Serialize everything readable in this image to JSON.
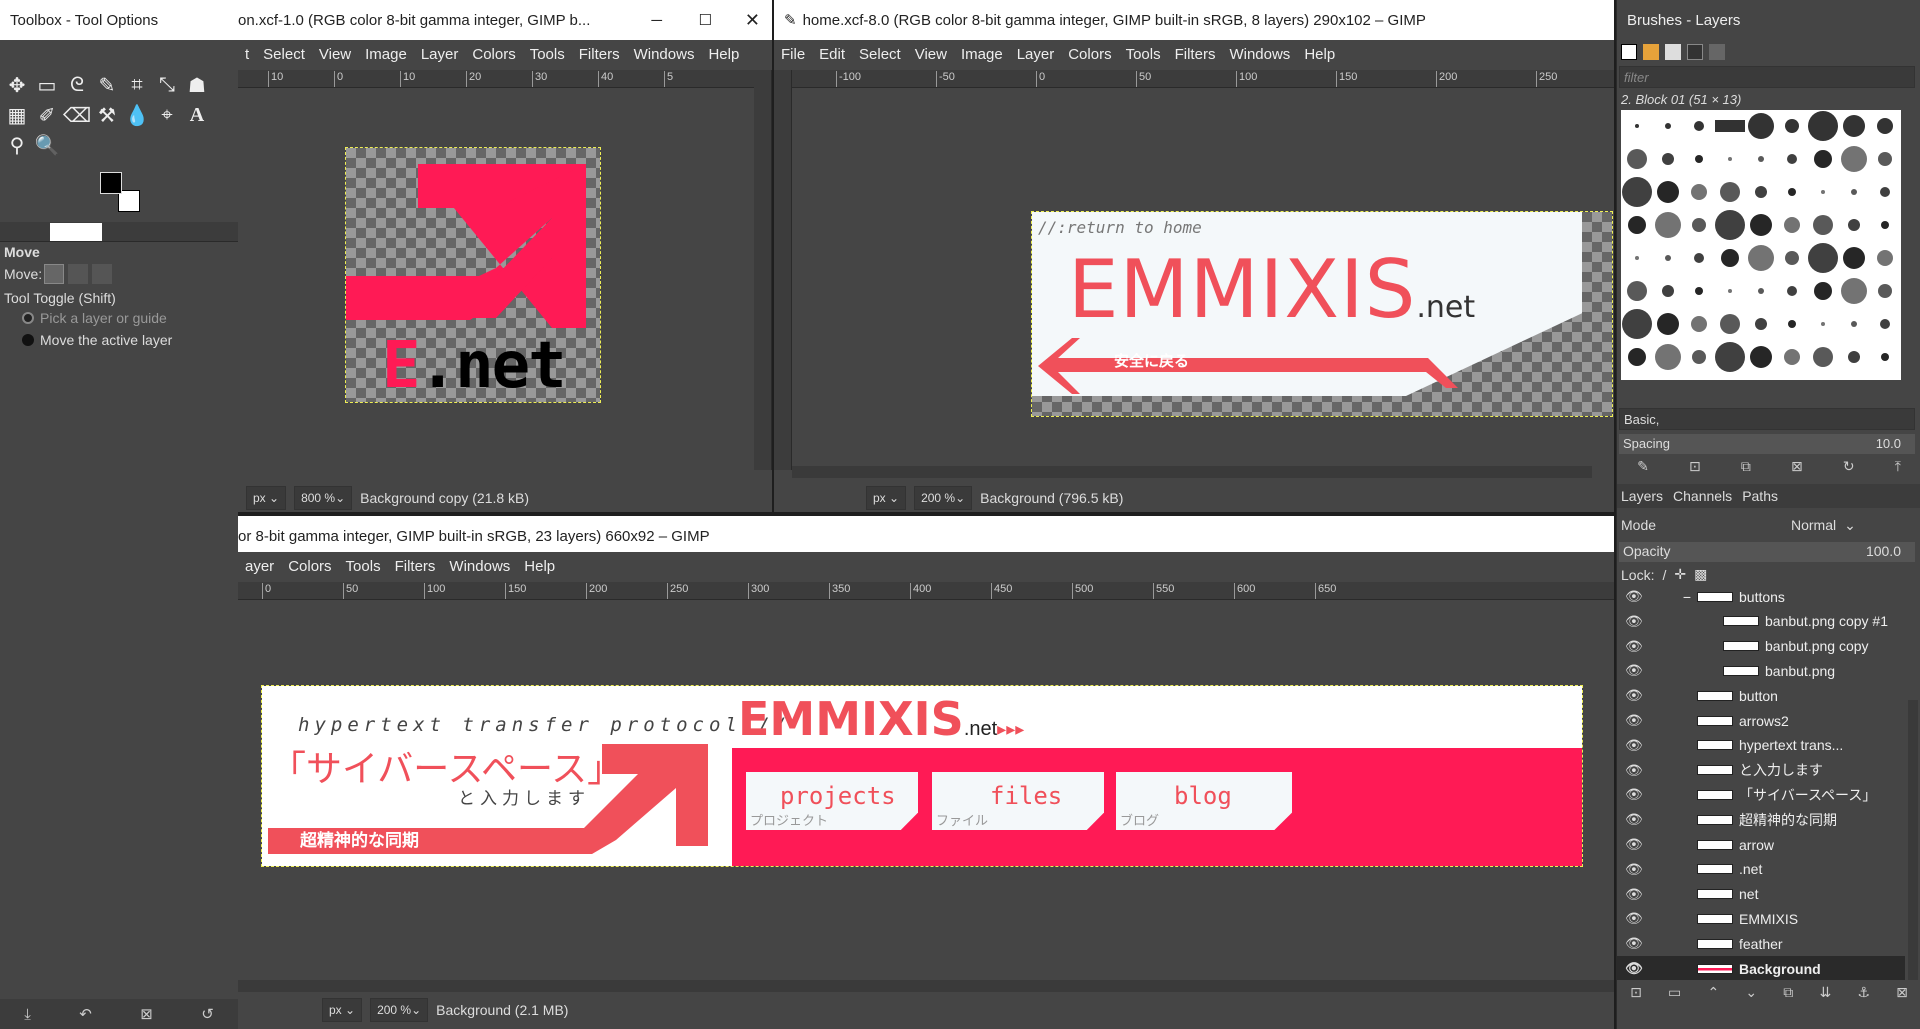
{
  "toolbox": {
    "title": "Toolbox - Tool Options",
    "tool_name": "Move",
    "move_label": "Move:",
    "toggle_label": "Tool Toggle  (Shift)",
    "option_pick": "Pick a layer or guide",
    "option_move": "Move the active layer"
  },
  "win_icon": {
    "title": "on.xcf-1.0 (RGB color 8-bit gamma integer, GIMP b...",
    "menu": [
      "t",
      "Select",
      "View",
      "Image",
      "Layer",
      "Colors",
      "Tools",
      "Filters",
      "Windows",
      "Help"
    ],
    "ruler_ticks": [
      "10",
      "0",
      "10",
      "20",
      "30",
      "40",
      "5"
    ],
    "unit": "px",
    "zoom": "800 %",
    "status": "Background copy (21.8 kB)",
    "canvas_text": "E.net"
  },
  "win_home": {
    "title": "home.xcf-8.0 (RGB color 8-bit gamma integer, GIMP built-in sRGB, 8 layers) 290x102 – GIMP",
    "menu": [
      "File",
      "Edit",
      "Select",
      "View",
      "Image",
      "Layer",
      "Colors",
      "Tools",
      "Filters",
      "Windows",
      "Help"
    ],
    "ruler_ticks": [
      "-100",
      "-50",
      "0",
      "50",
      "100",
      "150",
      "200",
      "250"
    ],
    "unit": "px",
    "zoom": "200 %",
    "status": "Background (796.5 kB)",
    "canvas": {
      "return_text": "//:return to home",
      "brand": "EMMIXIS",
      "brand_suffix": ".net",
      "jp_text": "安全に戻る"
    }
  },
  "win_main": {
    "title": "or 8-bit gamma integer, GIMP built-in sRGB, 23 layers) 660x92 – GIMP",
    "menu": [
      "ayer",
      "Colors",
      "Tools",
      "Filters",
      "Windows",
      "Help"
    ],
    "ruler_ticks": [
      "0",
      "50",
      "100",
      "150",
      "200",
      "250",
      "300",
      "350",
      "400",
      "450",
      "500",
      "550",
      "600",
      "650"
    ],
    "unit": "px",
    "zoom": "200 %",
    "status": "Background (2.1 MB)",
    "banner": {
      "protocol": "hypertext transfer protocol://",
      "brand": "EMMIXIS",
      "brand_suffix": ".net",
      "cyber": "「サイバースペース」",
      "input_text": "と入力します",
      "sync_text": "超精神的な同期",
      "tabs": [
        {
          "label": "projects",
          "sub": "プロジェクト"
        },
        {
          "label": "files",
          "sub": "ファイル"
        },
        {
          "label": "blog",
          "sub": "ブログ"
        }
      ]
    }
  },
  "brushes": {
    "title": "Brushes - Layers",
    "filter_placeholder": "filter",
    "selected_brush": "2. Block 01 (51 × 13)",
    "preset": "Basic,",
    "spacing_label": "Spacing",
    "spacing_value": "10.0"
  },
  "layers": {
    "tabs": [
      "Layers",
      "Channels",
      "Paths"
    ],
    "mode_label": "Mode",
    "mode_value": "Normal",
    "opacity_label": "Opacity",
    "opacity_value": "100.0",
    "lock_label": "Lock:",
    "items": [
      {
        "name": "buttons",
        "indent": 1,
        "group": true
      },
      {
        "name": "banbut.png copy #1",
        "indent": 2
      },
      {
        "name": "banbut.png copy",
        "indent": 2
      },
      {
        "name": "banbut.png",
        "indent": 2
      },
      {
        "name": "button",
        "indent": 1
      },
      {
        "name": "arrows2",
        "indent": 1
      },
      {
        "name": "hypertext trans...",
        "indent": 1
      },
      {
        "name": "と入力します",
        "indent": 1
      },
      {
        "name": "「サイバースペース」",
        "indent": 1
      },
      {
        "name": "超精神的な同期",
        "indent": 1
      },
      {
        "name": "arrow",
        "indent": 1
      },
      {
        "name": ".net",
        "indent": 1
      },
      {
        "name": "net",
        "indent": 1
      },
      {
        "name": "EMMIXIS",
        "indent": 1
      },
      {
        "name": "feather",
        "indent": 1
      },
      {
        "name": "Background",
        "indent": 1,
        "selected": true
      }
    ]
  },
  "colors": {
    "pink": "#ff1a55",
    "coral": "#f0505a",
    "panel": "#454545"
  }
}
